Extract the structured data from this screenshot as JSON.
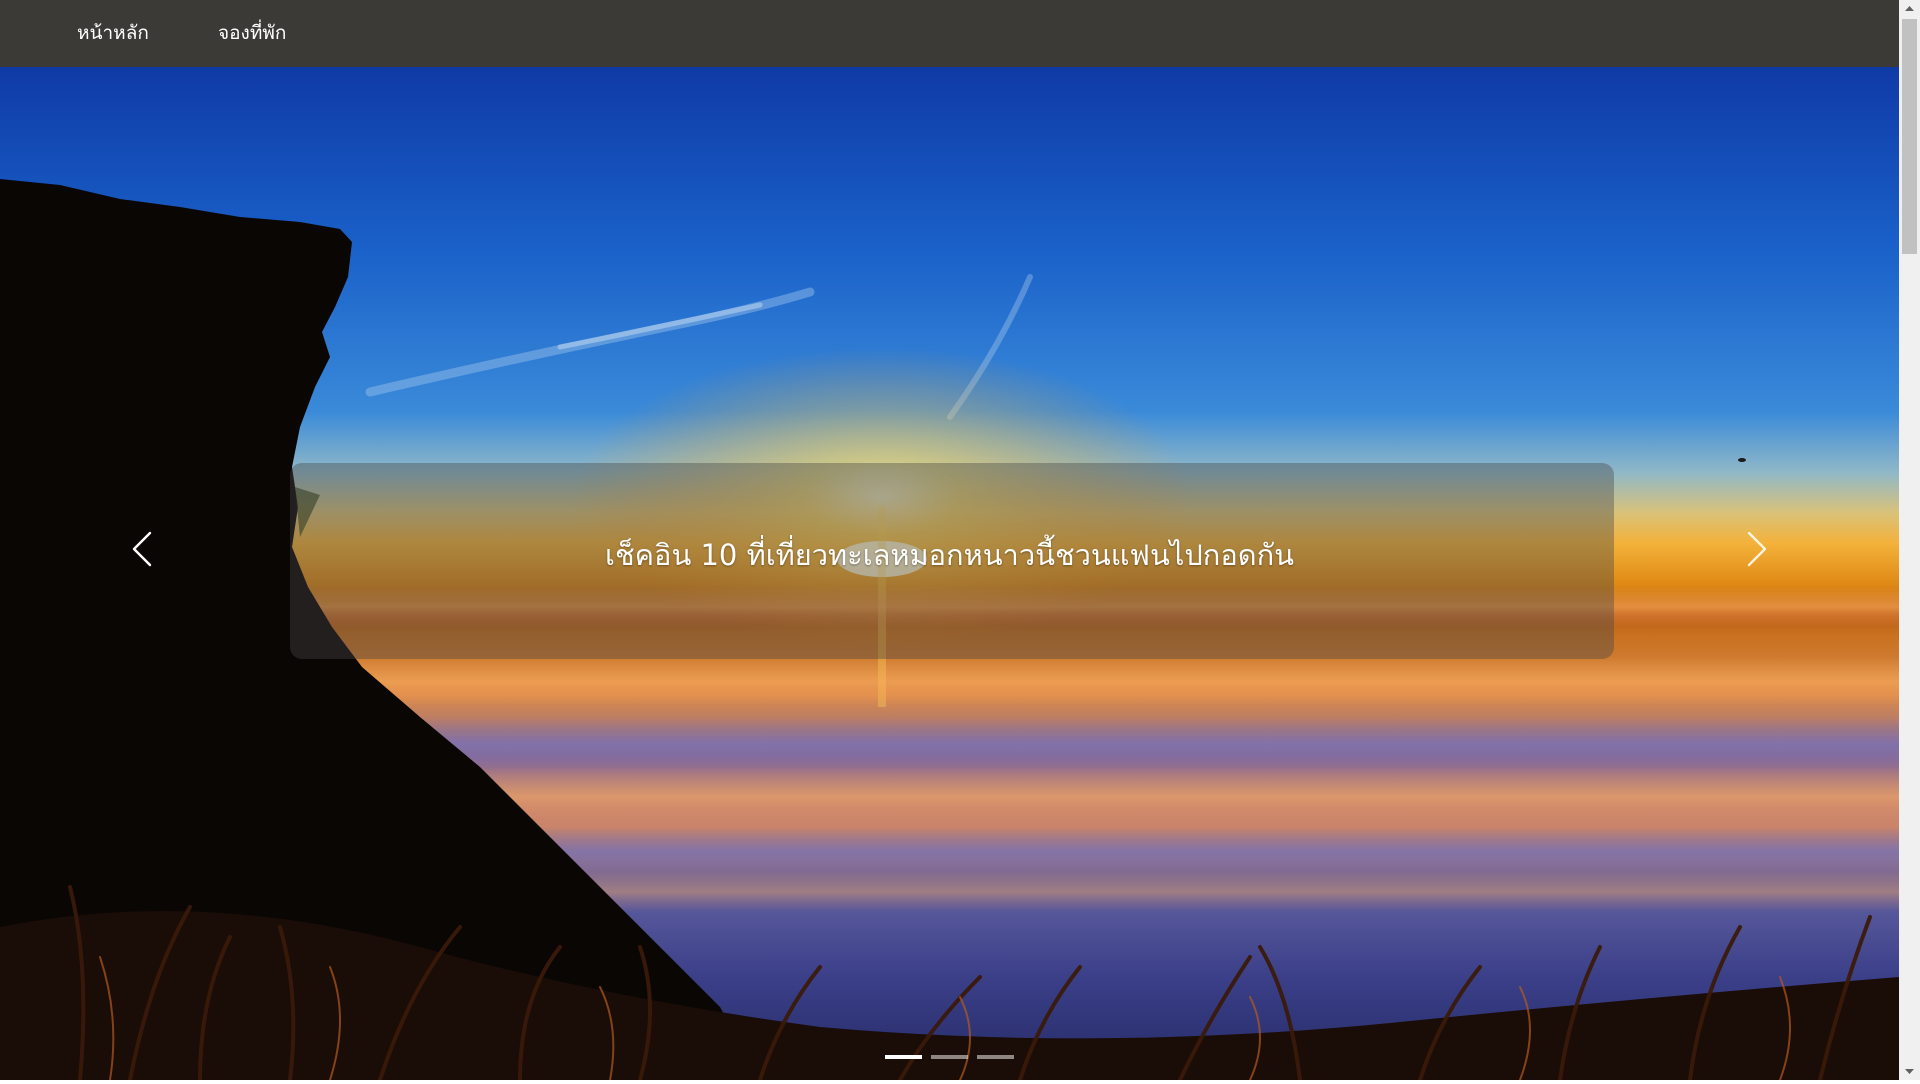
{
  "nav": {
    "items": [
      {
        "label": "หน้าหลัก"
      },
      {
        "label": "จองที่พัก"
      }
    ],
    "background_color": "#3c3a37"
  },
  "hero": {
    "caption": "เช็คอิน 10 ที่เที่ยวทะเลหมอกหนาวนี้ชวนแฟนไปกอดกัน",
    "scene": "sunrise over a sea of mist beside a dark cliff silhouette",
    "prev_icon": "chevron-left-icon",
    "next_icon": "chevron-right-icon",
    "slide_count": 3,
    "active_slide": 1
  },
  "scrollbar": {
    "up_icon": "scroll-up-arrow-icon",
    "down_icon": "scroll-down-arrow-icon"
  }
}
